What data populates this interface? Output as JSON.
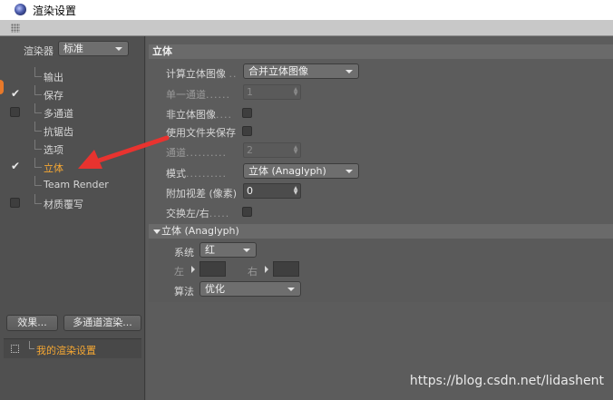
{
  "window": {
    "title": "渲染设置"
  },
  "sidebar": {
    "renderer_label": "渲染器",
    "renderer_value": "标准",
    "items": [
      {
        "label": "输出",
        "has_checkbox": false,
        "checked": false,
        "active": false
      },
      {
        "label": "保存",
        "has_checkbox": true,
        "checked": true,
        "active": false
      },
      {
        "label": "多通道",
        "has_checkbox": true,
        "checked": false,
        "active": false
      },
      {
        "label": "抗锯齿",
        "has_checkbox": false,
        "checked": false,
        "active": false
      },
      {
        "label": "选项",
        "has_checkbox": false,
        "checked": false,
        "active": false
      },
      {
        "label": "立体",
        "has_checkbox": true,
        "checked": true,
        "active": true
      },
      {
        "label": "Team Render",
        "has_checkbox": false,
        "checked": false,
        "active": false
      },
      {
        "label": "材质覆写",
        "has_checkbox": true,
        "checked": false,
        "active": false
      }
    ],
    "effects_button": "效果...",
    "multipass_button": "多通道渲染...",
    "preset_label": "我的渲染设置"
  },
  "panel": {
    "title": "立体",
    "calc_label": "计算立体图像",
    "calc_dots": "..",
    "calc_value": "合并立体图像",
    "single_label": "单一通道",
    "single_dots": "......",
    "single_value": "1",
    "non_label": "非立体图像",
    "non_dots": "....",
    "folder_label": "使用文件夹保存",
    "channels_label": "通道",
    "channels_dots": "..........",
    "channels_value": "2",
    "mode_label": "模式",
    "mode_dots": "..........",
    "mode_value": "立体 (Anaglyph)",
    "parallax_label": "附加视差 (像素)",
    "parallax_value": "0",
    "swap_label": "交换左/右",
    "swap_dots": "....."
  },
  "anaglyph": {
    "section_title": "立体 (Anaglyph)",
    "system_label": "系统",
    "system_value": "红",
    "left_label": "左",
    "right_label": "右",
    "method_label": "算法",
    "method_value": "优化"
  },
  "watermark": "https://blog.csdn.net/lidashent",
  "colors": {
    "accent_orange": "#f5a733",
    "arrow_red": "#e8332f"
  }
}
